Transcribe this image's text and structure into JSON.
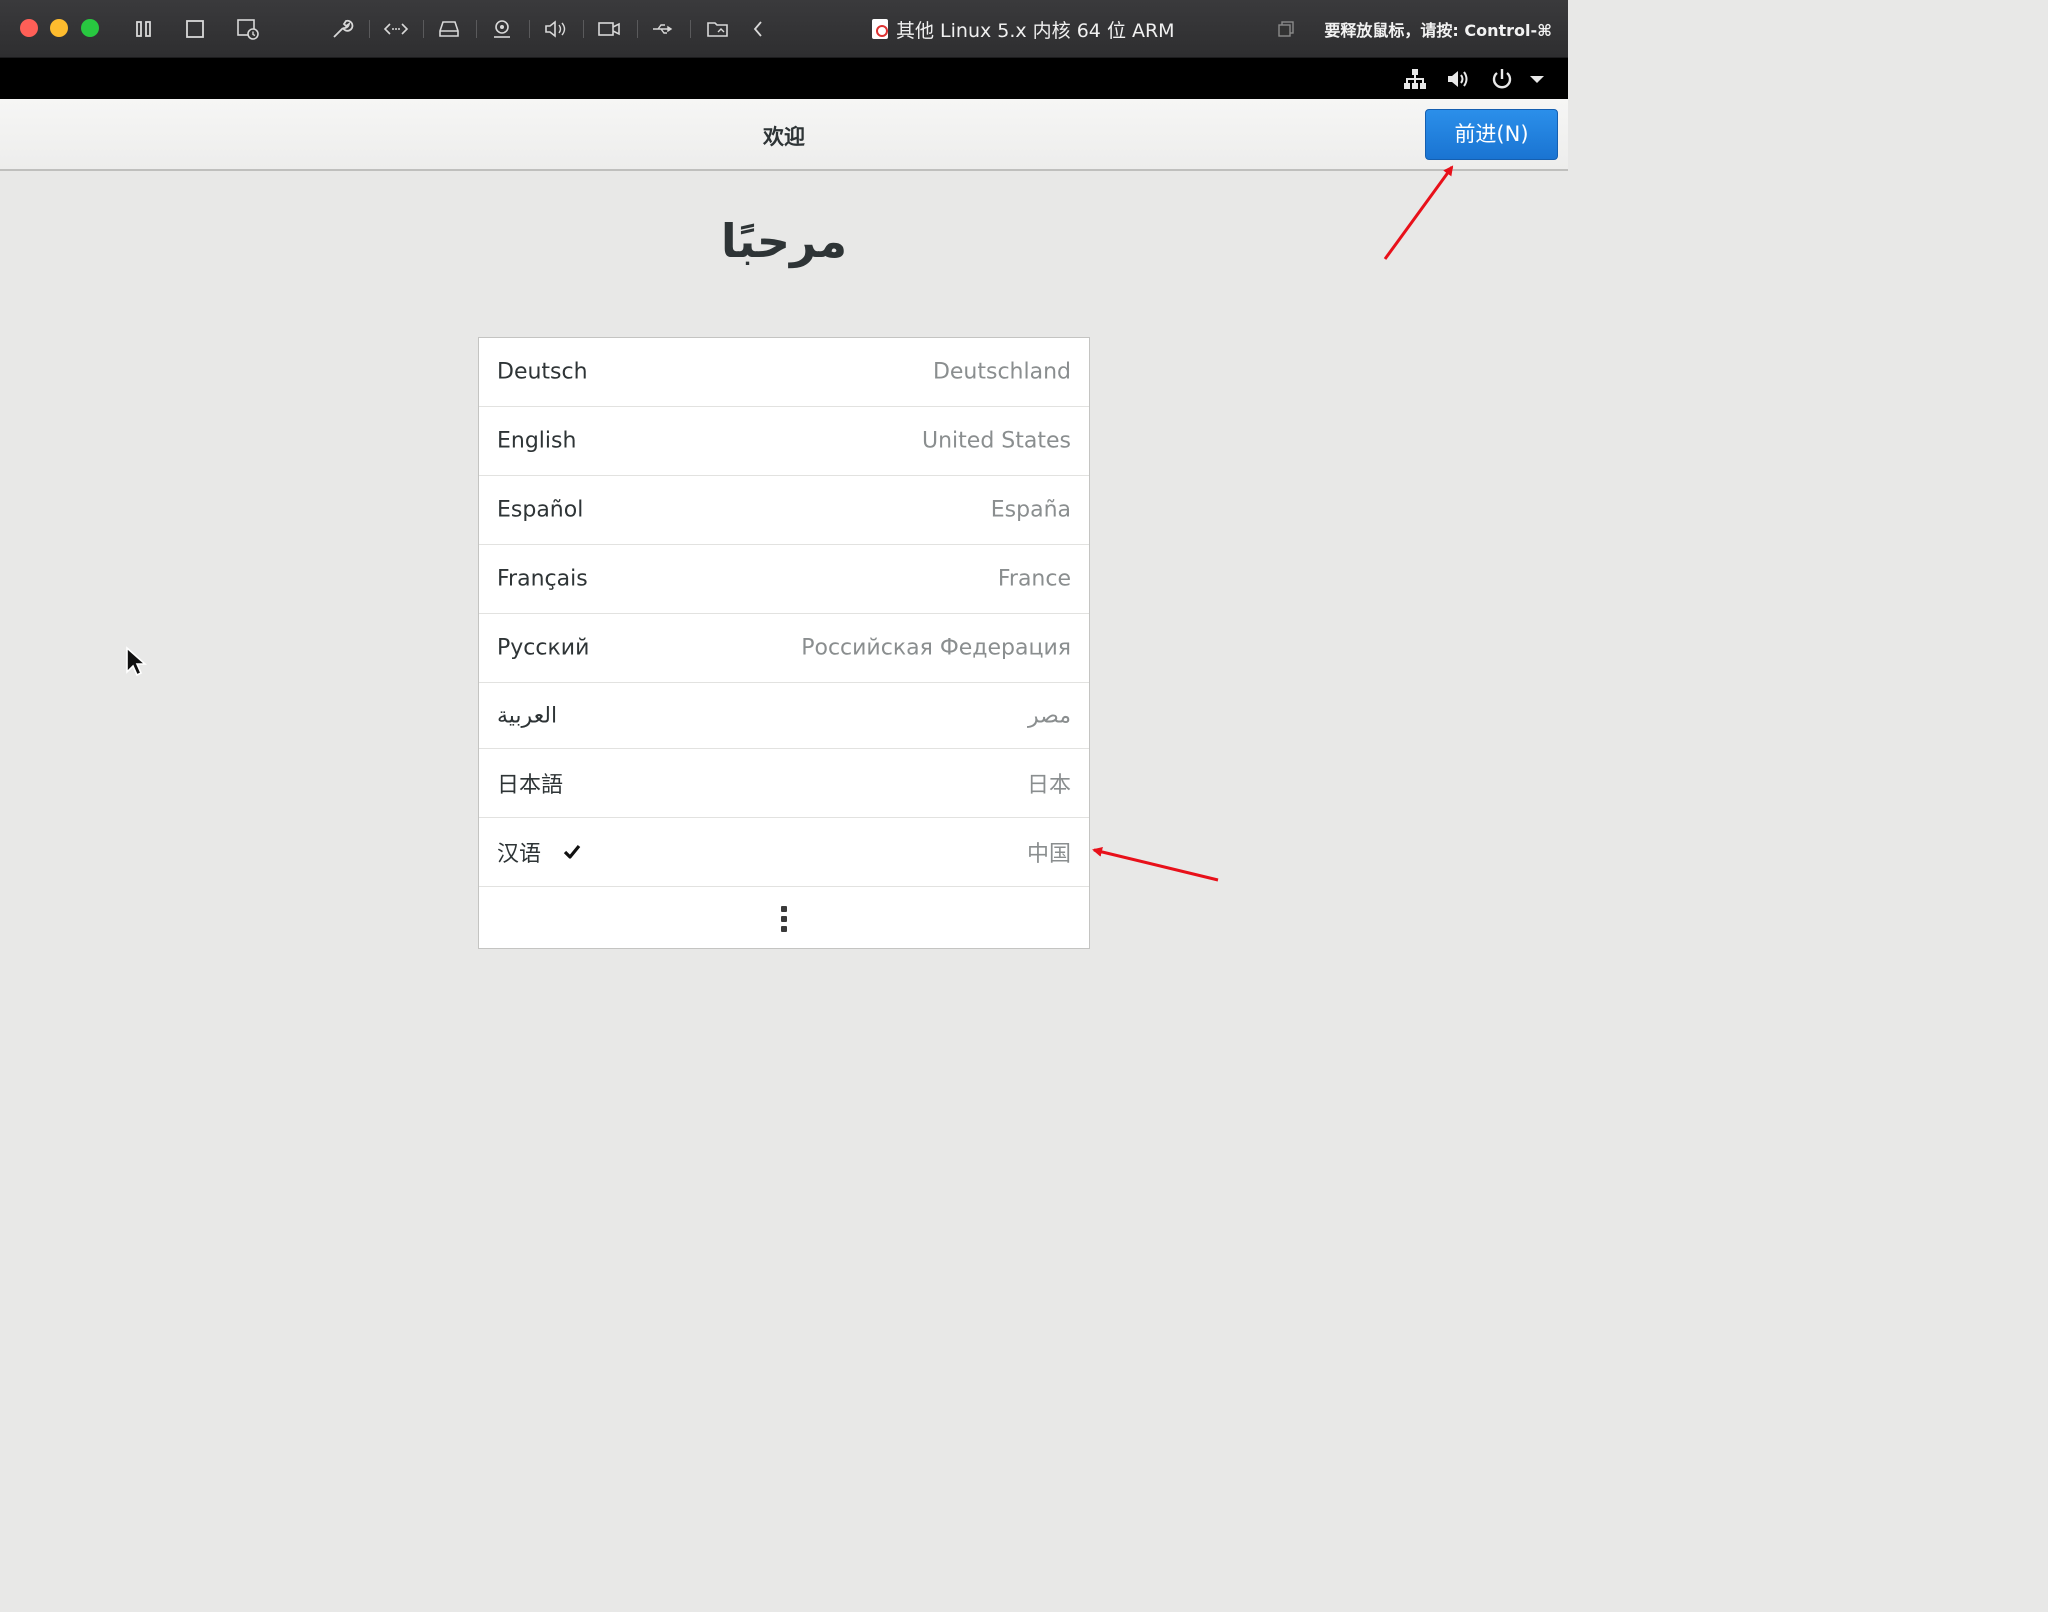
{
  "vm": {
    "title": "其他 Linux 5.x 内核 64 位 ARM",
    "release_hint": "要释放鼠标，请按: Control-⌘"
  },
  "toolbar_icons": [
    "pause-icon",
    "stop-icon",
    "snapshot-icon",
    "settings-wrench-icon",
    "network-arrows-icon",
    "disk-icon",
    "camera-icon",
    "sound-icon",
    "video-icon",
    "usb-icon",
    "shared-folder-icon",
    "back-chevron-icon"
  ],
  "guest_panel": {
    "icons": [
      "network-icon",
      "volume-icon",
      "power-icon",
      "dropdown-arrow-icon"
    ]
  },
  "header": {
    "title": "欢迎",
    "next_label": "前进(N)"
  },
  "welcome_text": "مرحبًا",
  "languages": [
    {
      "name": "Deutsch",
      "region": "Deutschland",
      "selected": false
    },
    {
      "name": "English",
      "region": "United States",
      "selected": false
    },
    {
      "name": "Español",
      "region": "España",
      "selected": false
    },
    {
      "name": "Français",
      "region": "France",
      "selected": false
    },
    {
      "name": "Русский",
      "region": "Российская Федерация",
      "selected": false
    },
    {
      "name": "العربية",
      "region": "مصر",
      "selected": false
    },
    {
      "name": "日本語",
      "region": "日本",
      "selected": false
    },
    {
      "name": "汉语",
      "region": "中国",
      "selected": true
    }
  ],
  "colors": {
    "accent": "#1a74d2",
    "annotation_arrow": "#e8101a"
  }
}
